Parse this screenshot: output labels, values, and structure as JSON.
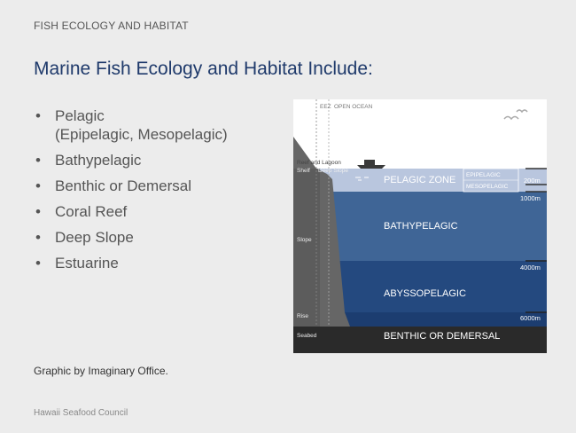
{
  "header": {
    "section": "FISH ECOLOGY AND HABITAT"
  },
  "title": "Marine Fish Ecology and Habitat Include:",
  "bullets": [
    {
      "label": "Pelagic",
      "sub": "(Epipelagic, Mesopelagic)"
    },
    {
      "label": "Bathypelagic"
    },
    {
      "label": "Benthic or Demersal"
    },
    {
      "label": "Coral Reef"
    },
    {
      "label": "Deep Slope"
    },
    {
      "label": "Estuarine"
    }
  ],
  "credit": "Graphic by Imaginary Office.",
  "footer": "Hawaii Seafood Council",
  "diagram": {
    "top_labels": {
      "eez": "EEZ",
      "open_ocean": "OPEN OCEAN"
    },
    "left_labels": {
      "reef": "Reef and Lagoon",
      "shelf": "Shelf",
      "deep_slope": "Deep Slope",
      "slope": "Slope",
      "rise": "Rise",
      "seabed": "Seabed"
    },
    "zones": {
      "pelagic": "PELAGIC ZONE",
      "epipelagic": "EPIPELAGIC",
      "mesopelagic": "MESOPELAGIC",
      "bathypelagic": "BATHYPELAGIC",
      "abyssopelagic": "ABYSSOPELAGIC",
      "benthic": "BENTHIC OR DEMERSAL"
    },
    "depths": {
      "d200": "200m",
      "d1000": "1000m",
      "d4000": "4000m",
      "d6000": "6000m"
    },
    "colors": {
      "sky": "#ffffff",
      "pelagic": "#b9c6de",
      "bathypelagic": "#3f6596",
      "abyssopelagic": "#24497f",
      "deep": "#1c3d70",
      "seabed": "#2a2a2a",
      "land": "#666666"
    }
  }
}
